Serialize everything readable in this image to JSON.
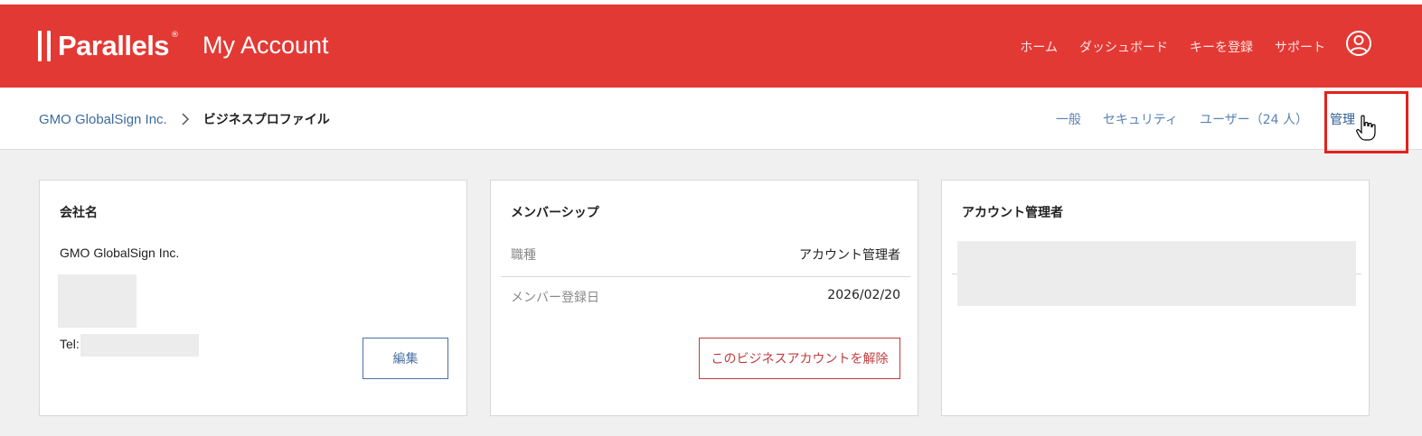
{
  "header": {
    "brand": "Parallels",
    "brand_mark": "®",
    "app_title": "My Account",
    "nav": [
      "ホーム",
      "ダッシュボード",
      "キーを登録",
      "サポート"
    ],
    "account_icon": "user-circle-icon"
  },
  "subbar": {
    "breadcrumb_link": "GMO GlobalSign Inc.",
    "breadcrumb_current": "ビジネスプロファイル",
    "tabs": [
      "一般",
      "セキュリティ",
      "ユーザー（24 人）",
      "管理"
    ]
  },
  "company_card": {
    "title": "会社名",
    "company_name": "GMO GlobalSign Inc.",
    "tel_label": "Tel:",
    "edit_button": "編集"
  },
  "membership_card": {
    "title": "メンバーシップ",
    "rows": [
      {
        "label": "職種",
        "value": "アカウント管理者"
      },
      {
        "label": "メンバー登録日",
        "value": "2026/02/20"
      }
    ],
    "leave_button": "このビジネスアカウントを解除"
  },
  "admin_card": {
    "title": "アカウント管理者"
  },
  "colors": {
    "header_bg": "#e33934",
    "link": "#3e6a9e",
    "danger": "#c23b3b",
    "highlight": "#e3211c"
  }
}
